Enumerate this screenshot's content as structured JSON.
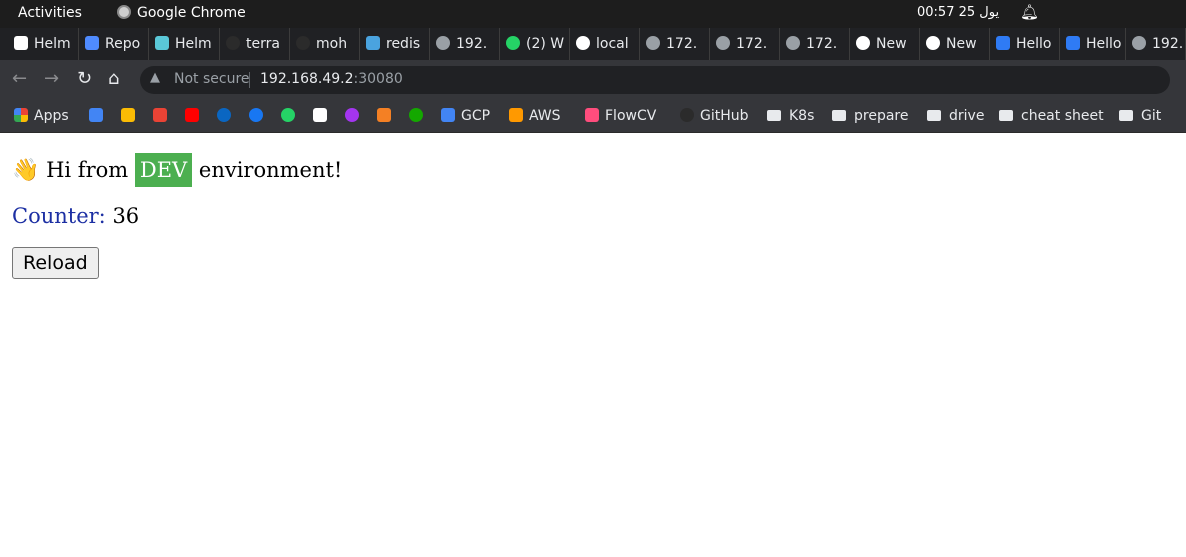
{
  "system_bar": {
    "activities": "Activities",
    "app_name": "Google Chrome",
    "clock": "00:57  25 يول",
    "bell_icon": "bell-icon"
  },
  "tabs": [
    {
      "label": "Helm",
      "icon": "jetbrains-icon",
      "color": "#ffffff"
    },
    {
      "label": "Repo",
      "icon": "repo-icon",
      "color": "#4f8bff"
    },
    {
      "label": "Helm",
      "icon": "helm-icon",
      "color": "#5ac8d8"
    },
    {
      "label": "terra",
      "icon": "github-icon",
      "color": "#2b2b2b"
    },
    {
      "label": "moh",
      "icon": "github-icon",
      "color": "#2b2b2b"
    },
    {
      "label": "redis",
      "icon": "hex-icon",
      "color": "#4aa3df"
    },
    {
      "label": "192.",
      "icon": "globe-icon",
      "color": "#9aa0a6"
    },
    {
      "label": "(2) W",
      "icon": "whatsapp-icon",
      "color": "#25d366"
    },
    {
      "label": "local",
      "icon": "google-icon",
      "color": "#ffffff"
    },
    {
      "label": "172.",
      "icon": "globe-icon",
      "color": "#9aa0a6"
    },
    {
      "label": "172.",
      "icon": "globe-icon",
      "color": "#9aa0a6"
    },
    {
      "label": "172.",
      "icon": "globe-icon",
      "color": "#9aa0a6"
    },
    {
      "label": "New",
      "icon": "chrome-icon",
      "color": "#ffffff"
    },
    {
      "label": "New",
      "icon": "chrome-icon",
      "color": "#ffffff"
    },
    {
      "label": "Hello",
      "icon": "cloud-icon",
      "color": "#2f7bf5"
    },
    {
      "label": "Hello",
      "icon": "cloud-icon",
      "color": "#2f7bf5"
    },
    {
      "label": "192.",
      "icon": "globe-icon",
      "color": "#9aa0a6"
    }
  ],
  "address_bar": {
    "security": "Not secure",
    "host": "192.168.49.2",
    "port": ":30080"
  },
  "bookmarks": {
    "apps_label": "Apps",
    "icons": [
      {
        "name": "google-translate-icon",
        "color": "#4285f4"
      },
      {
        "name": "google-drive-icon",
        "color": "#fbbc04"
      },
      {
        "name": "gmail-icon",
        "color": "#ea4335"
      },
      {
        "name": "youtube-icon",
        "color": "#ff0000"
      },
      {
        "name": "linkedin-icon",
        "color": "#0a66c2"
      },
      {
        "name": "facebook-icon",
        "color": "#1877f2"
      },
      {
        "name": "whatsapp-icon",
        "color": "#25d366"
      },
      {
        "name": "notion-icon",
        "color": "#ffffff"
      },
      {
        "name": "udemy-icon",
        "color": "#a435f0"
      },
      {
        "name": "stackoverflow-icon",
        "color": "#f48024"
      },
      {
        "name": "upwork-icon",
        "color": "#14a800"
      }
    ],
    "items": [
      {
        "label": "GCP",
        "icon": "gcp-icon",
        "color": "#4285f4"
      },
      {
        "label": "AWS",
        "icon": "aws-icon",
        "color": "#ff9900"
      },
      {
        "label": "FlowCV",
        "icon": "flowcv-icon",
        "color": "#ff4d7d"
      },
      {
        "label": "GitHub",
        "icon": "github-icon",
        "color": "#2b2b2b"
      }
    ],
    "folders": [
      "K8s",
      "prepare",
      "drive",
      "cheat sheet",
      "Git"
    ]
  },
  "page": {
    "greeting_prefix": "Hi from",
    "environment": "DEV",
    "greeting_suffix": "environment!",
    "counter_label": "Counter:",
    "counter_value": "36",
    "reload_label": "Reload",
    "colors": {
      "badge": "#4caf50",
      "counter_label": "#1c2fa3"
    }
  }
}
